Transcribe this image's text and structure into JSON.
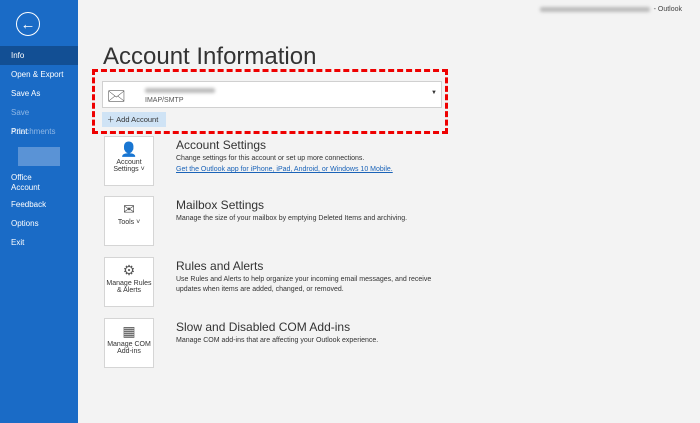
{
  "titlebar": {
    "app": "- Outlook"
  },
  "sidebar": {
    "items": [
      "Info",
      "Open & Export",
      "Save As",
      "Save Attachments",
      "Print",
      "Office Account",
      "Feedback",
      "Options",
      "Exit"
    ]
  },
  "main": {
    "title": "Account Information",
    "account": {
      "type": "IMAP/SMTP",
      "add": "Add Account"
    },
    "sections": [
      {
        "tile": "Account Settings ˅",
        "title": "Account Settings",
        "desc": "Change settings for this account or set up more connections.",
        "link": "Get the Outlook app for iPhone, iPad, Android, or Windows 10 Mobile."
      },
      {
        "tile": "Tools ˅",
        "title": "Mailbox Settings",
        "desc": "Manage the size of your mailbox by emptying Deleted Items and archiving."
      },
      {
        "tile": "Manage Rules & Alerts",
        "title": "Rules and Alerts",
        "desc": "Use Rules and Alerts to help organize your incoming email messages, and receive updates when items are added, changed, or removed."
      },
      {
        "tile": "Manage COM Add-ins",
        "title": "Slow and Disabled COM Add-ins",
        "desc": "Manage COM add-ins that are affecting your Outlook experience."
      }
    ]
  }
}
